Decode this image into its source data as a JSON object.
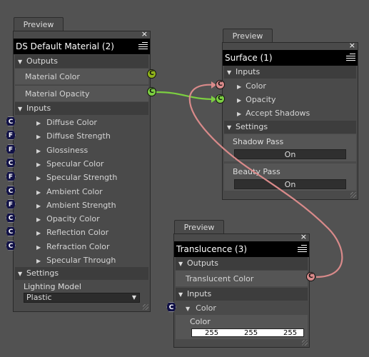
{
  "nodes": {
    "material": {
      "preview": "Preview",
      "title": "DS Default Material (2)",
      "outputs_label": "Outputs",
      "outputs": [
        "Material Color",
        "Material Opacity"
      ],
      "inputs_label": "Inputs",
      "inputs": [
        {
          "label": "Diffuse Color",
          "port": "C"
        },
        {
          "label": "Diffuse Strength",
          "port": "F"
        },
        {
          "label": "Glossiness",
          "port": "F"
        },
        {
          "label": "Specular Color",
          "port": "C"
        },
        {
          "label": "Specular Strength",
          "port": "F"
        },
        {
          "label": "Ambient Color",
          "port": "C"
        },
        {
          "label": "Ambient Strength",
          "port": "F"
        },
        {
          "label": "Opacity Color",
          "port": "C"
        },
        {
          "label": "Reflection Color",
          "port": "C"
        },
        {
          "label": "Refraction Color",
          "port": "C"
        },
        {
          "label": "Specular Through Opacity",
          "port": ""
        }
      ],
      "settings_label": "Settings",
      "lighting_model_label": "Lighting Model",
      "lighting_model_value": "Plastic"
    },
    "surface": {
      "preview": "Preview",
      "title": "Surface (1)",
      "inputs_label": "Inputs",
      "inputs": [
        "Color",
        "Opacity",
        "Accept Shadows"
      ],
      "settings_label": "Settings",
      "shadow_pass_label": "Shadow Pass",
      "shadow_pass_value": "On",
      "beauty_pass_label": "Beauty Pass",
      "beauty_pass_value": "On"
    },
    "translucence": {
      "preview": "Preview",
      "title": "Translucence (3)",
      "outputs_label": "Outputs",
      "output": "Translucent Color",
      "inputs_label": "Inputs",
      "input": "Color",
      "color_label": "Color",
      "rgb": [
        "255",
        "255",
        "255"
      ]
    }
  },
  "port_letters": {
    "color": "C",
    "float": "F"
  },
  "close_glyph": "×",
  "colors": {
    "background": "#525252",
    "wire_pink": "#d98a8a",
    "wire_green": "#7ccf41",
    "port_yellow": "#8fb21a"
  }
}
